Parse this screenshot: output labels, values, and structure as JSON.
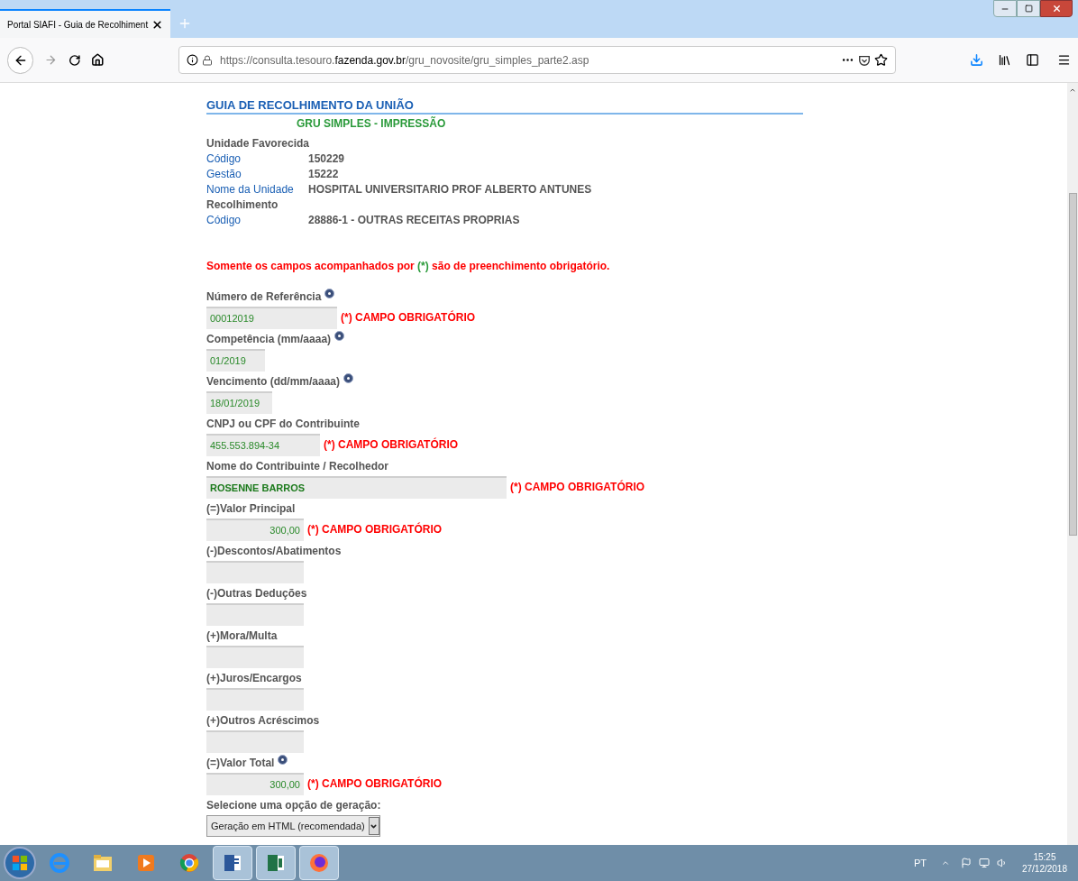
{
  "browser": {
    "tab": {
      "title": "Portal SIAFI - Guia de Recolhiment",
      "selected": true
    },
    "url": {
      "prefix": "https://consulta.tesouro.",
      "domain": "fazenda.gov.br",
      "path": "/gru_novosite/gru_simples_parte2.asp"
    }
  },
  "page": {
    "title": "GUIA DE RECOLHIMENTO DA UNIÃO",
    "subtitle": "GRU SIMPLES - IMPRESSÃO",
    "info": [
      {
        "kind": "section",
        "label": "Unidade Favorecida"
      },
      {
        "kind": "row",
        "label": "Código",
        "value": "150229"
      },
      {
        "kind": "row",
        "label": "Gestão",
        "value": "15222"
      },
      {
        "kind": "row",
        "label": "Nome da Unidade",
        "value": "HOSPITAL UNIVERSITARIO PROF ALBERTO ANTUNES"
      },
      {
        "kind": "section",
        "label": "Recolhimento"
      },
      {
        "kind": "row",
        "label": "Código",
        "value": "28886-1 - OUTRAS RECEITAS PROPRIAS"
      }
    ],
    "notice": {
      "before": "Somente os campos acompanhados por ",
      "mark": "(*)",
      "after": " são de preenchimento obrigatório."
    },
    "fields": [
      {
        "kind": "text",
        "label": "Número de Referência",
        "help": true,
        "value": "00012019",
        "strong": false,
        "required_note": "(*) CAMPO OBRIGATÓRIO"
      },
      {
        "kind": "text",
        "label": "Competência (mm/aaaa)",
        "help": true,
        "value": "01/2019",
        "strong": false
      },
      {
        "kind": "text",
        "label": "Vencimento (dd/mm/aaaa)",
        "help": true,
        "value": "18/01/2019",
        "strong": false
      },
      {
        "kind": "text",
        "label": "CNPJ ou CPF do Contribuinte",
        "help": false,
        "value": "455.553.894-34",
        "strong": false,
        "required_note": "(*) CAMPO OBRIGATÓRIO"
      },
      {
        "kind": "text",
        "label": "Nome do Contribuinte / Recolhedor",
        "help": false,
        "value": "ROSENNE BARROS",
        "strong": true,
        "required_note": "(*) CAMPO OBRIGATÓRIO"
      },
      {
        "kind": "amount",
        "label": "(=)Valor Principal",
        "help": false,
        "value": "300,00",
        "strong": false,
        "required_note": "(*) CAMPO OBRIGATÓRIO"
      },
      {
        "kind": "amount",
        "label": "(-)Descontos/Abatimentos",
        "help": false
      },
      {
        "kind": "amount",
        "label": "(-)Outras Deduções",
        "help": false
      },
      {
        "kind": "amount",
        "label": "(+)Mora/Multa",
        "help": false
      },
      {
        "kind": "amount",
        "label": "(+)Juros/Encargos",
        "help": false
      },
      {
        "kind": "amount",
        "label": "(+)Outros Acréscimos",
        "help": false
      },
      {
        "kind": "amount",
        "label": "(=)Valor Total",
        "help": true,
        "value": "300,00",
        "strong": false,
        "required_note": "(*) CAMPO OBRIGATÓRIO"
      },
      {
        "kind": "select",
        "label": "Selecione uma opção de geração:",
        "help": false,
        "value": "Geração em HTML (recomendada)"
      }
    ]
  },
  "taskbar": {
    "language": "PT",
    "time": "15:25",
    "date": "27/12/2018"
  }
}
